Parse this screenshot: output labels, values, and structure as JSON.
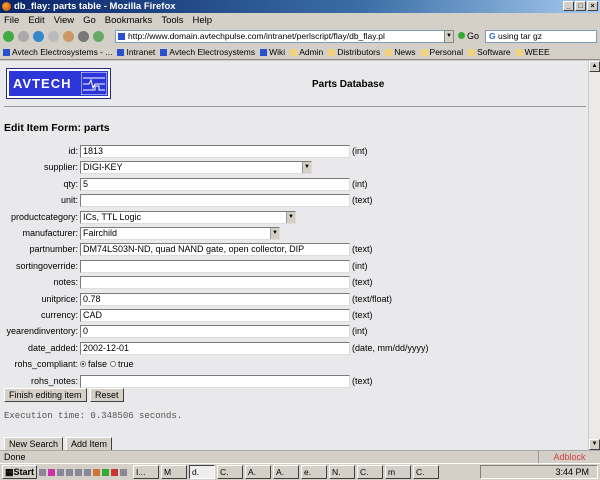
{
  "window": {
    "title": "db_flay: parts table - Mozilla Firefox"
  },
  "menu": [
    "File",
    "Edit",
    "View",
    "Go",
    "Bookmarks",
    "Tools",
    "Help"
  ],
  "nav": {
    "url": "http://www.domain.avtechpulse.com/intranet/perlscript/flay/db_flay.pl",
    "go_label": "Go",
    "search_value": "using tar gz"
  },
  "bookmarks": [
    {
      "label": "Avtech Electrosystems - ...",
      "icon": "page"
    },
    {
      "label": "Intranet",
      "icon": "page"
    },
    {
      "label": "Avtech Electrosystems",
      "icon": "page"
    },
    {
      "label": "Wiki",
      "icon": "page"
    },
    {
      "label": "Admin",
      "icon": "folder"
    },
    {
      "label": "Distributors",
      "icon": "folder"
    },
    {
      "label": "News",
      "icon": "folder"
    },
    {
      "label": "Personal",
      "icon": "folder"
    },
    {
      "label": "Software",
      "icon": "folder"
    },
    {
      "label": "WEEE",
      "icon": "folder"
    }
  ],
  "page": {
    "logo_text": "AVTECH",
    "title": "Parts Database",
    "form_title": "Edit Item Form: parts",
    "fields": [
      {
        "label": "id:",
        "kind": "text",
        "value": "1813",
        "type": "(int)"
      },
      {
        "label": "supplier:",
        "kind": "select",
        "value": "DIGI-KEY",
        "type": ""
      },
      {
        "label": "qty:",
        "kind": "text",
        "value": "5",
        "type": "(int)"
      },
      {
        "label": "unit:",
        "kind": "text",
        "value": "",
        "type": "(text)"
      },
      {
        "label": "productcategory:",
        "kind": "select",
        "value": "ICs, TTL Logic",
        "type": ""
      },
      {
        "label": "manufacturer:",
        "kind": "select",
        "value": "Fairchild",
        "type": ""
      },
      {
        "label": "partnumber:",
        "kind": "text",
        "value": "DM74LS03N-ND, quad NAND gate, open collector, DIP",
        "type": "(text)"
      },
      {
        "label": "sortingoverride:",
        "kind": "text",
        "value": "",
        "type": "(int)"
      },
      {
        "label": "notes:",
        "kind": "text",
        "value": "",
        "type": "(text)"
      },
      {
        "label": "unitprice:",
        "kind": "text",
        "value": "0.78",
        "type": "(text/float)"
      },
      {
        "label": "currency:",
        "kind": "text",
        "value": "CAD",
        "type": "(text)"
      },
      {
        "label": "yearendinventory:",
        "kind": "text",
        "value": "0",
        "type": "(int)"
      },
      {
        "label": "date_added:",
        "kind": "text",
        "value": "2002-12-01",
        "type": "(date, mm/dd/yyyy)"
      },
      {
        "label": "rohs_compliant:",
        "kind": "radio",
        "options": [
          "false",
          "true"
        ],
        "selected": "false",
        "type": ""
      },
      {
        "label": "rohs_notes:",
        "kind": "text",
        "value": "",
        "type": "(text)"
      }
    ],
    "finish_label": "Finish editing item",
    "reset_label": "Reset",
    "exec_time": "Execution time: 0.348506 seconds.",
    "new_search_label": "New Search",
    "add_item_label": "Add Item"
  },
  "status": {
    "text": "Done",
    "adblock": "Adblock"
  },
  "taskbar": {
    "start": "Start",
    "tasks": [
      "I...",
      "M",
      "d.",
      "C.",
      "A.",
      "A.",
      "e.",
      "N.",
      "C.",
      "m",
      "C."
    ],
    "active": 2,
    "clock": "3:44 PM"
  }
}
